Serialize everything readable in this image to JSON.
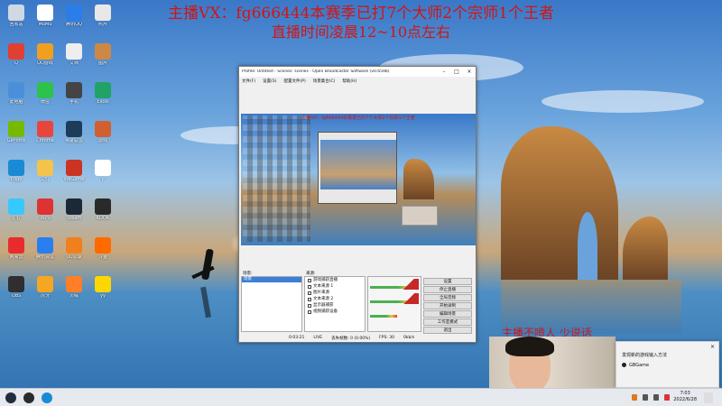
{
  "banner": {
    "line1": "主播VX：fg666444本赛季已打7个大师2个宗师1个王者",
    "line2": "直播时间凌晨12~10点左右",
    "overlay": "主播不喷人 少说话"
  },
  "obs": {
    "title": "Profile: Untitled - Scenes: scenes - Open Broadcaster Software (v0.659b)",
    "menu": [
      "文件(F)",
      "设置(S)",
      "配置文件(P)",
      "场景集合(C)",
      "帮助(H)"
    ],
    "scenes_header": "场景:",
    "scene_selected": "场景",
    "sources_header": "来源:",
    "sources": [
      "游戏捕获直播",
      "文本来源 1",
      "图片来源",
      "文本来源 2",
      "显示器捕获",
      "视频捕获设备"
    ],
    "controls": [
      "设置",
      "停止直播",
      "全局音频",
      "开始录制",
      "编辑场景",
      "工作室模式",
      "退出"
    ],
    "status": {
      "time": "0:03:21",
      "live": "LIVE",
      "dropped": "丢失帧数: 0 (0.00%)",
      "fps": "FPS: 30",
      "kbps": "0kb/s"
    }
  },
  "notification": {
    "title": "发现新的游戏输入方法",
    "app": "GBGame"
  },
  "taskbar": {
    "time": "7:03",
    "date": "2022/6/28"
  },
  "desktop_icons": [
    {
      "label": "回收站",
      "color": "#cfd8e3"
    },
    {
      "label": "MuMu",
      "color": "#ffffff"
    },
    {
      "label": "腾讯QQ",
      "color": "#2b7de9"
    },
    {
      "label": "照片",
      "color": "#e8e8e8"
    },
    {
      "label": "Q",
      "color": "#e04030"
    },
    {
      "label": "QQ游戏",
      "color": "#f0a020"
    },
    {
      "label": "文档",
      "color": "#eeeeee"
    },
    {
      "label": "图片",
      "color": "#cc8844"
    },
    {
      "label": "此电脑",
      "color": "#4a90d9"
    },
    {
      "label": "微信",
      "color": "#2dc24a"
    },
    {
      "label": "手机",
      "color": "#444444"
    },
    {
      "label": "Excel",
      "color": "#21a366"
    },
    {
      "label": "GeForce",
      "color": "#76b900"
    },
    {
      "label": "Chrome",
      "color": "#e8453c"
    },
    {
      "label": "英雄联盟",
      "color": "#1d3c5a"
    },
    {
      "label": "游戏",
      "color": "#d06030"
    },
    {
      "label": "Edge",
      "color": "#1a8ad4"
    },
    {
      "label": "文件",
      "color": "#f3c34c"
    },
    {
      "label": "WeGame",
      "color": "#cc3322"
    },
    {
      "label": "P",
      "color": "#ffffff"
    },
    {
      "label": "钉钉",
      "color": "#35c9ff"
    },
    {
      "label": "WPS",
      "color": "#d33"
    },
    {
      "label": "Steam",
      "color": "#1b2838"
    },
    {
      "label": "KOOK",
      "color": "#2a2a2a"
    },
    {
      "label": "网易云",
      "color": "#e82c2c"
    },
    {
      "label": "腾讯会议",
      "color": "#2a7ff0"
    },
    {
      "label": "UU加速",
      "color": "#f07f1e"
    },
    {
      "label": "斗鱼",
      "color": "#ff6a00"
    },
    {
      "label": "OBS",
      "color": "#302e31"
    },
    {
      "label": "虎牙",
      "color": "#f5a623"
    },
    {
      "label": "火绒",
      "color": "#ff7f27"
    },
    {
      "label": "yy",
      "color": "#ffd700"
    }
  ]
}
